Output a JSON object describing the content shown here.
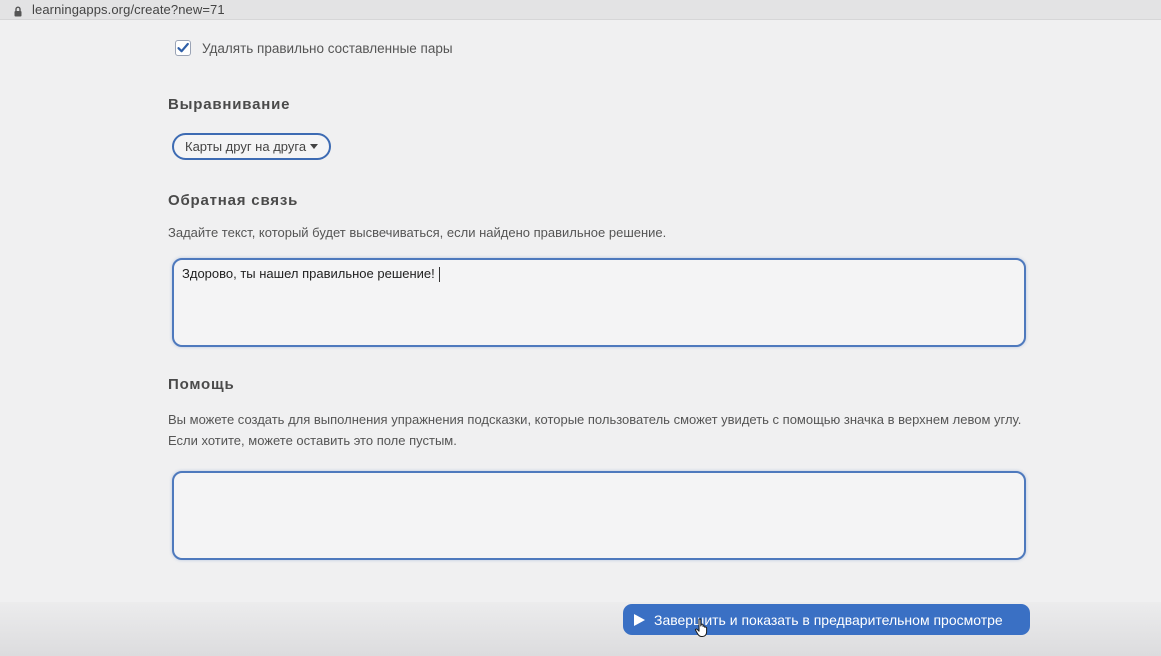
{
  "browser": {
    "url": "learningapps.org/create?new=71"
  },
  "options": {
    "remove_pairs_label": "Удалять правильно составленные пары",
    "remove_pairs_checked": true
  },
  "alignment": {
    "title": "Выравнивание",
    "selected": "Карты друг на друга"
  },
  "feedback": {
    "title": "Обратная связь",
    "description": "Задайте текст, который будет высвечиваться, если найдено правильное решение.",
    "value": "Здорово, ты нашел правильное решение!"
  },
  "help": {
    "title": "Помощь",
    "description_line1": "Вы можете создать для выполнения упражнения подсказки, которые пользователь сможет увидеть с помощью значка в верхнем левом углу.",
    "description_line2": "Если хотите, можете оставить это поле пустым.",
    "value": ""
  },
  "actions": {
    "finish_label": "Завершить и показать в предварительном просмотре"
  },
  "colors": {
    "accent": "#3a70c4",
    "border": "#4e79bd",
    "background": "#f0f0f1"
  },
  "icons": {
    "lock": "lock-icon",
    "check": "check-icon",
    "caret": "caret-down-icon",
    "play": "play-icon",
    "cursor": "hand-pointer-icon"
  }
}
